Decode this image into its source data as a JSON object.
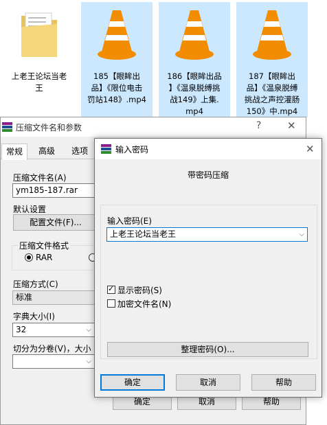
{
  "explorer": {
    "files": [
      {
        "name": "上老王论坛当老\n王",
        "icon": "folder-icon"
      },
      {
        "name": "185【眼眸出\n品】《限位电击\n罚站148》.mp4",
        "icon": "vlc-cone-icon"
      },
      {
        "name": "186【眼眸出品\n】《温泉脱缚挑\n战149》上集.\nmp4",
        "icon": "vlc-cone-icon"
      },
      {
        "name": "187【眼眸出\n品】《温泉脱缚\n挑战之声控灌肠\n150》中.mp4",
        "icon": "vlc-cone-icon"
      }
    ]
  },
  "archive_dialog": {
    "title": "压缩文件名和参数",
    "help_glyph": "?",
    "close_glyph": "✕",
    "tabs": [
      "常规",
      "高级",
      "选项"
    ],
    "archive_name_label": "压缩文件名(A)",
    "archive_name_value": "ym185-187.rar",
    "default_settings_label": "默认设置",
    "profiles_button": "配置文件(F)...",
    "format_group_label": "压缩文件格式",
    "format_rar": "RAR",
    "method_label": "压缩方式(C)",
    "method_value": "标准",
    "dict_label": "字典大小(I)",
    "dict_value": "32",
    "split_label": "切分为分卷(V)，大小",
    "ok": "确定",
    "cancel": "取消",
    "help": "帮助"
  },
  "password_dialog": {
    "title": "输入密码",
    "close_glyph": "✕",
    "heading": "带密码压缩",
    "input_label": "输入密码(E)",
    "input_value": "上老王论坛当老王",
    "show_password": "显示密码(S)",
    "show_password_checked": true,
    "encrypt_names": "加密文件名(N)",
    "encrypt_names_checked": false,
    "organize_button": "整理密码(O)...",
    "ok": "确定",
    "cancel": "取消",
    "help": "帮助"
  },
  "colors": {
    "selection": "#cce8ff",
    "accent": "#0078d7",
    "dialog_bg": "#f0f0f0",
    "cone_orange": "#f28c00"
  }
}
